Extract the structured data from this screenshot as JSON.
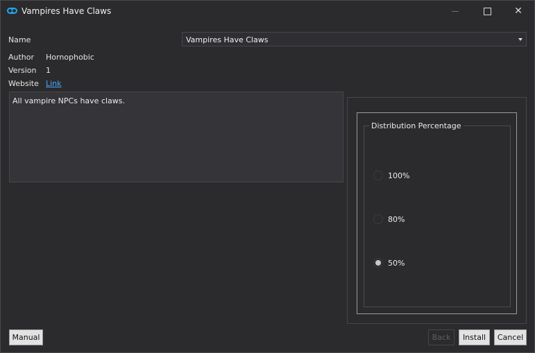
{
  "window": {
    "title": "Vampires Have Claws",
    "controls": {
      "minimize": "minimize",
      "maximize": "maximize",
      "close": "✕"
    }
  },
  "info": {
    "name_label": "Name",
    "name_value": "Vampires Have Claws",
    "author_label": "Author",
    "author_value": "Hornophobic",
    "version_label": "Version",
    "version_value": "1",
    "website_label": "Website",
    "website_link": "Link"
  },
  "description": "All vampire NPCs have claws.",
  "options": {
    "group_title": "Distribution Percentage",
    "items": [
      {
        "label": "100%",
        "selected": false
      },
      {
        "label": "80%",
        "selected": false
      },
      {
        "label": "50%",
        "selected": true
      }
    ]
  },
  "footer": {
    "manual": "Manual",
    "back": "Back",
    "install": "Install",
    "cancel": "Cancel"
  },
  "colors": {
    "background": "#2b2b2e",
    "accent": "#2fa3e0",
    "link": "#4aa8ff"
  },
  "icons": {
    "app": "app-logo-icon",
    "dropdown": "chevron-down-icon"
  }
}
